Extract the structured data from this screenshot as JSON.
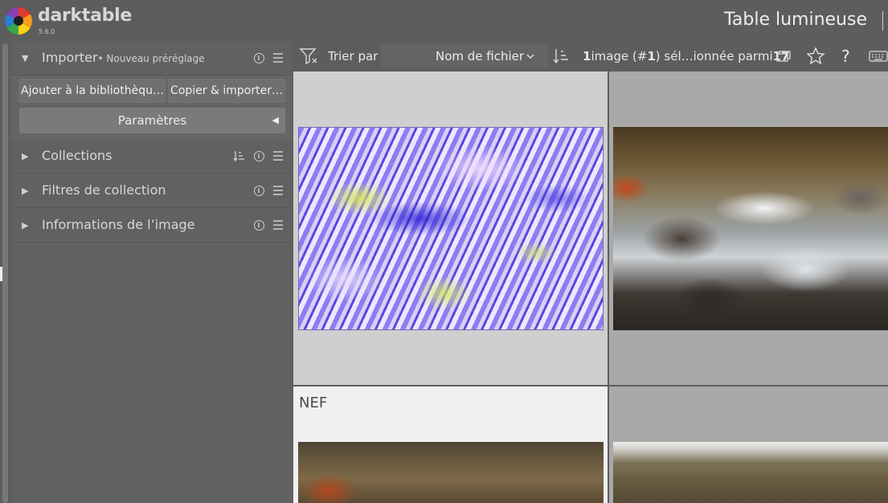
{
  "app": {
    "name": "darktable",
    "version": "5.6.0",
    "view_title": "Table lumineuse"
  },
  "left_panel": {
    "import_module": {
      "title": "Importer",
      "preset": "• Nouveau préréglage",
      "add_to_library_label": "Ajouter à la bibliothèqu…",
      "copy_import_label": "Copier & importer…",
      "parameters_label": "Paramètres"
    },
    "modules": [
      {
        "label": "Collections"
      },
      {
        "label": "Filtres de collection"
      },
      {
        "label": "Informations de l’image"
      }
    ]
  },
  "toolbar": {
    "sort_label": "Trier par",
    "sort_value": "Nom de fichier",
    "selection_count": "1",
    "selection_mid": " image (#",
    "selection_index": "1",
    "selection_rest": ") sél…ionnée parmi ",
    "total_count": "17",
    "help_glyph": "?"
  },
  "grid": {
    "cells": [
      {
        "label": "",
        "selected": true
      },
      {
        "label": "",
        "selected": false
      },
      {
        "label": "NEF",
        "selected": false
      },
      {
        "label": "",
        "selected": false
      }
    ]
  },
  "colors": {
    "panel_bg": "#616161",
    "header_bg": "#5d5d5d",
    "cell_selected_bg": "#cfcfcf",
    "cell_hover_bg": "#f0f0f0",
    "cell_bg": "#a9a9a9"
  },
  "icons": [
    "darktable-logo",
    "filter-funnel-icon",
    "sort-order-icon",
    "grouping-icon",
    "star-icon",
    "help-icon",
    "keyboard-icon",
    "info-icon",
    "hamburger-menu-icon",
    "sort-lines-icon"
  ]
}
